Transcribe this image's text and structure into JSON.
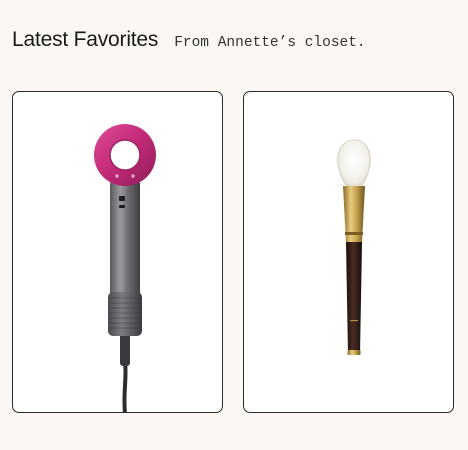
{
  "header": {
    "title": "Latest Favorites",
    "subtitle": "From Annette’s closet."
  },
  "products": [
    {
      "name": "hair-dryer",
      "icon": "hair-dryer-icon",
      "accent": "#c22a78"
    },
    {
      "name": "makeup-brush",
      "icon": "makeup-brush-icon",
      "accent": "#c8a550"
    }
  ],
  "colors": {
    "background": "#fbf7f2",
    "card_border": "#2b2b2b",
    "card_background": "#ffffff"
  }
}
